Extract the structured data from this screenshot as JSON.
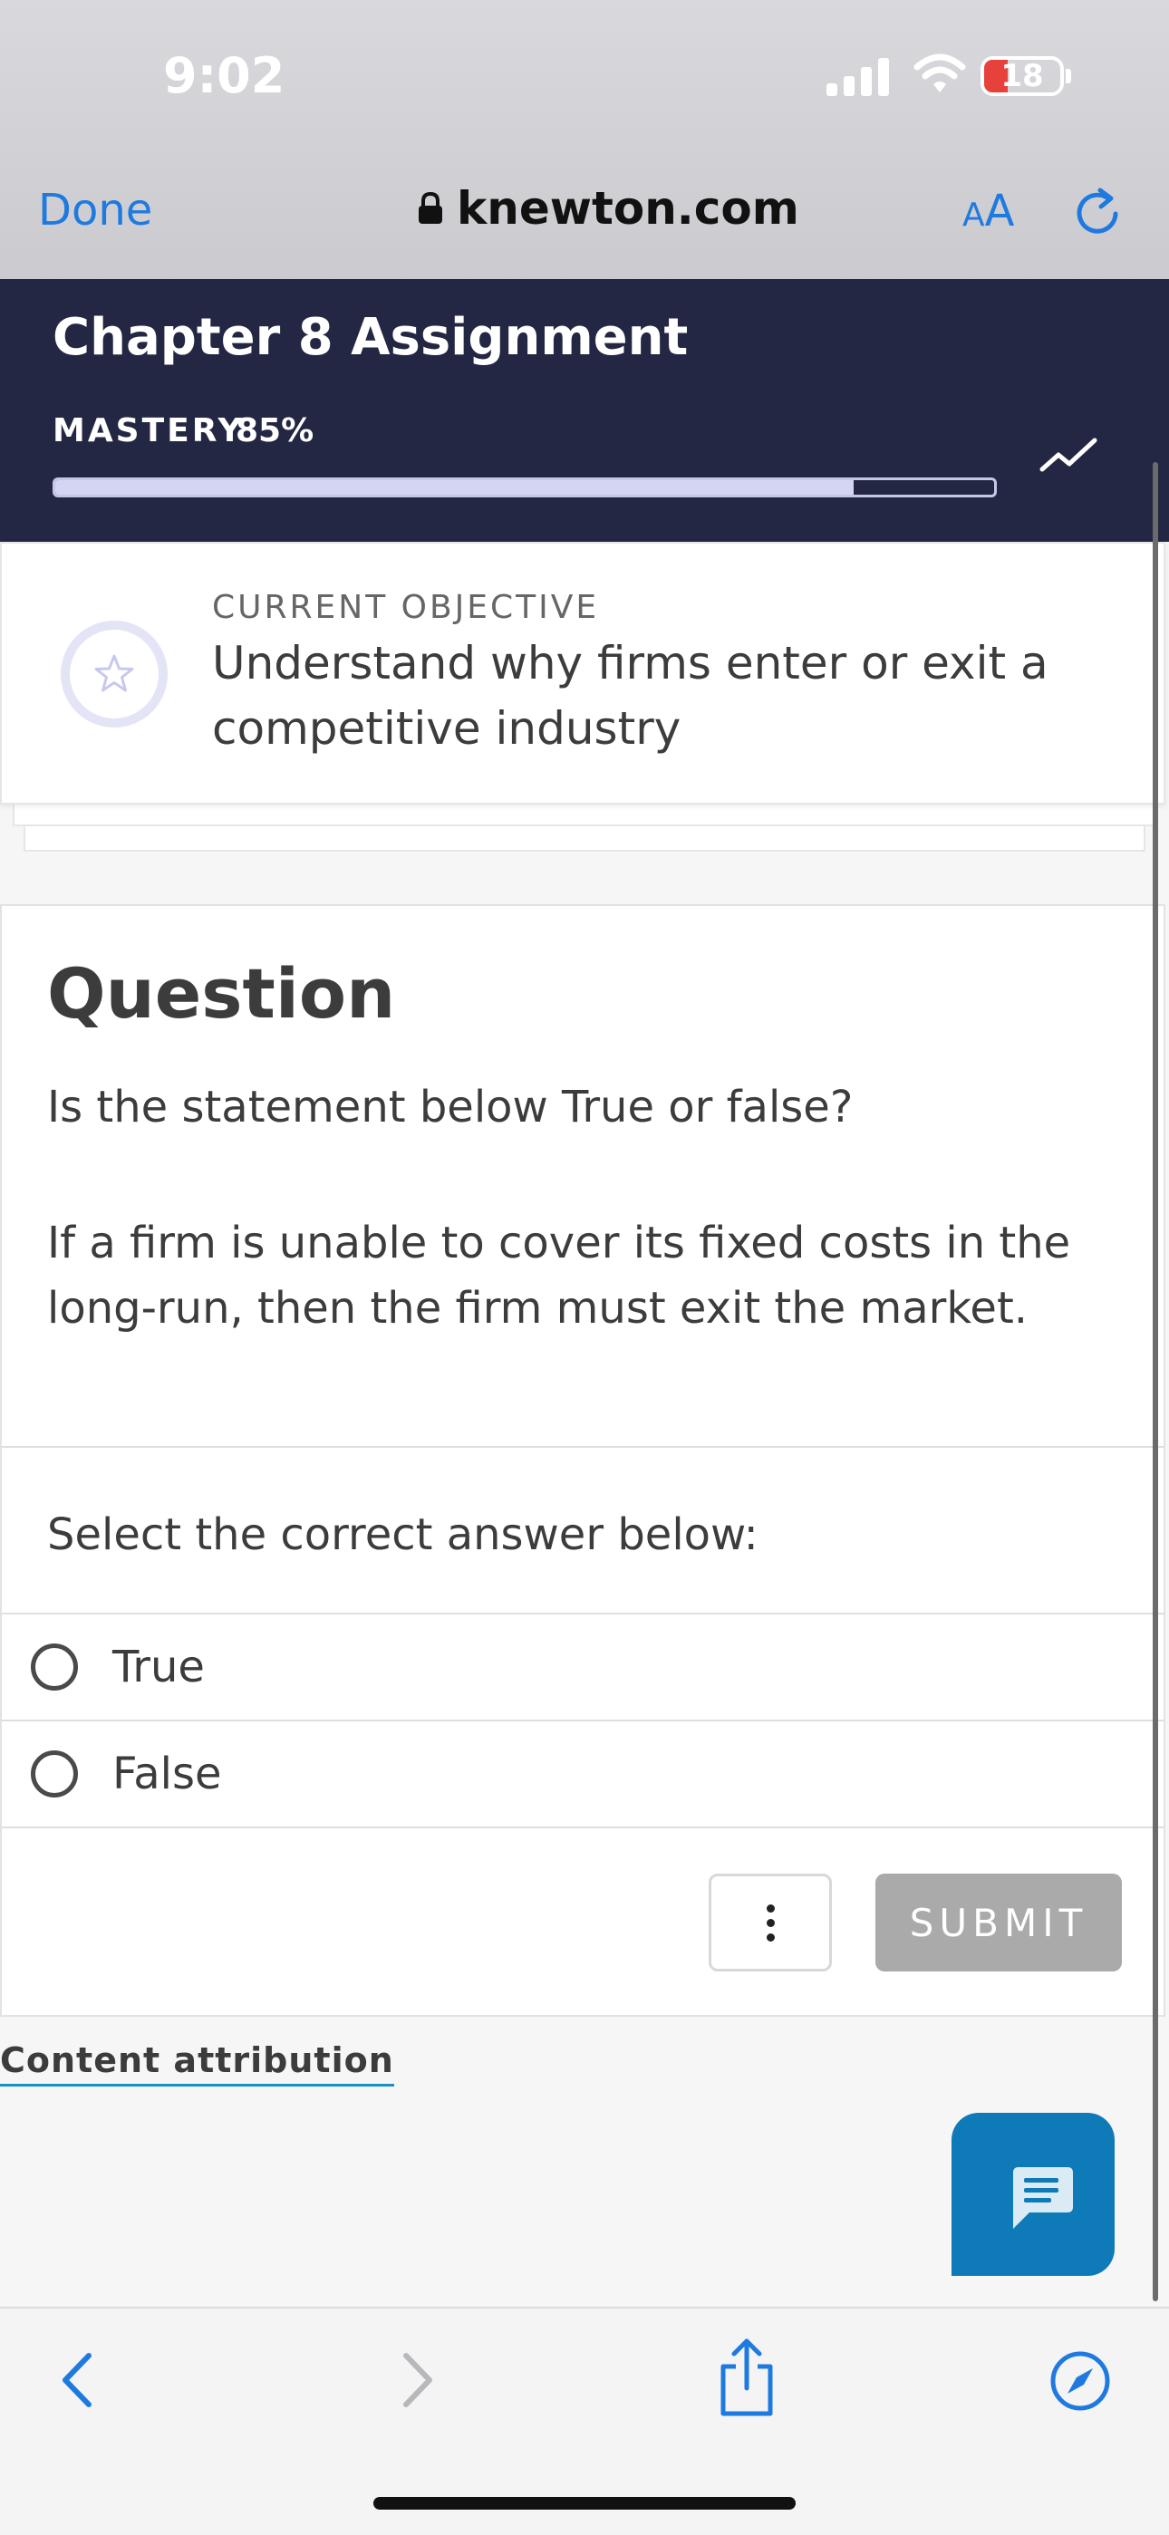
{
  "status_bar": {
    "time": "9:02",
    "battery_level": "18"
  },
  "browser": {
    "done_label": "Done",
    "url": "knewton.com",
    "text_size_small": "A",
    "text_size_large": "A"
  },
  "assignment": {
    "title": "Chapter 8 Assignment",
    "mastery_label": "MASTERY",
    "mastery_value": "85%",
    "mastery_fraction": 0.85
  },
  "objective": {
    "label": "CURRENT OBJECTIVE",
    "text": "Understand why firms enter or exit a competitive industry"
  },
  "question": {
    "heading": "Question",
    "prompt": "Is the statement below True or false?",
    "statement": "If a firm is unable to cover its fixed costs in the long-run, then the firm must exit the market.",
    "select_label": "Select the correct answer below:",
    "options": [
      {
        "label": "True"
      },
      {
        "label": "False"
      }
    ],
    "submit_label": "SUBMIT"
  },
  "footer": {
    "attribution_label": "Content attribution"
  },
  "colors": {
    "header_bg": "#232743",
    "link_blue": "#1f7ae0",
    "chat_button": "#0e7ab8",
    "submit_disabled": "#aaaaaa",
    "battery_low": "#e8413b"
  },
  "icons": {
    "lock": "lock-icon",
    "reload": "reload-icon",
    "trend": "trend-icon",
    "objective": "star-icon",
    "more": "vertical-ellipsis-icon",
    "chat": "chat-icon",
    "back": "chevron-left-icon",
    "forward": "chevron-right-icon",
    "share": "share-icon",
    "compass": "compass-icon"
  }
}
